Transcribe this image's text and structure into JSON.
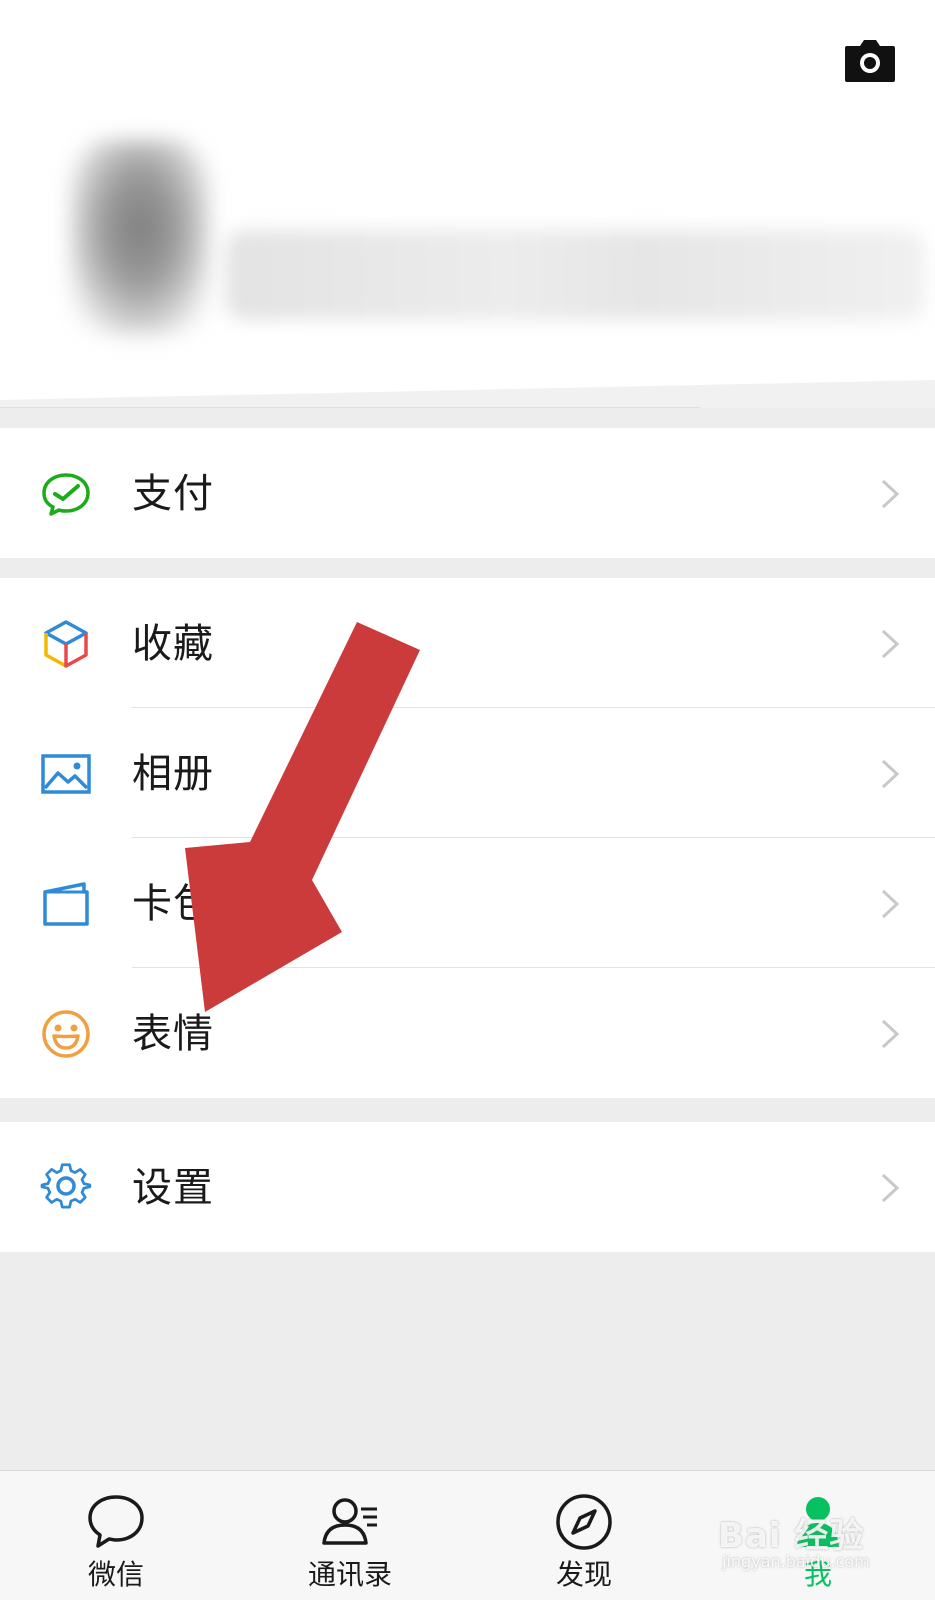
{
  "header": {
    "camera_icon": "camera-icon"
  },
  "menu": {
    "group1": [
      {
        "label": "支付",
        "icon": "wechat-pay-icon"
      }
    ],
    "group2": [
      {
        "label": "收藏",
        "icon": "favorites-cube-icon"
      },
      {
        "label": "相册",
        "icon": "album-icon"
      },
      {
        "label": "卡包",
        "icon": "card-wallet-icon"
      },
      {
        "label": "表情",
        "icon": "sticker-smile-icon"
      }
    ],
    "group3": [
      {
        "label": "设置",
        "icon": "settings-gear-icon"
      }
    ]
  },
  "tabbar": {
    "tabs": [
      {
        "label": "微信",
        "icon": "chat-bubble-icon",
        "active": false
      },
      {
        "label": "通讯录",
        "icon": "contacts-icon",
        "active": false
      },
      {
        "label": "发现",
        "icon": "compass-icon",
        "active": false
      },
      {
        "label": "我",
        "icon": "me-person-icon",
        "active": true
      }
    ]
  },
  "watermark": {
    "logo": "Bai 经验",
    "url": "jingyan.baidu.com"
  },
  "colors": {
    "accent_green": "#07c160",
    "pay_green": "#1aad19",
    "annotation_red": "#cc3b3b",
    "icon_blue": "#2f8ad8",
    "smile_orange": "#f0a040"
  }
}
